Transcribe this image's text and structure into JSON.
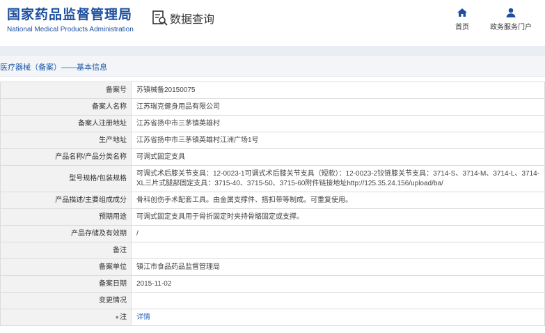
{
  "header": {
    "logo_cn": "国家药品监督管理局",
    "logo_en": "National Medical Products Administration",
    "query_label": "数据查询",
    "nav": [
      {
        "label": "首页",
        "icon": "home-icon"
      },
      {
        "label": "政务服务门户",
        "icon": "user-icon"
      }
    ]
  },
  "breadcrumb": "医疗器械（备案）——基本信息",
  "rows": [
    {
      "label": "备案号",
      "value": "苏镇械备20150075"
    },
    {
      "label": "备案人名称",
      "value": "江苏瑞克健身用品有限公司"
    },
    {
      "label": "备案人注册地址",
      "value": "江苏省扬中市三茅镇英雄村"
    },
    {
      "label": "生产地址",
      "value": "江苏省扬中市三茅镇英雄村江洲广场1号"
    },
    {
      "label": "产品名称/产品分类名称",
      "value": "可调式固定支具"
    },
    {
      "label": "型号规格/包装规格",
      "value": "可调式术后膝关节支具：12-0023-1可调式术后膝关节支具（短款）：12-0023-2铰链膝关节支具：3714-S、3714-M、3714-L、3714-XL三片式腿部固定支具：3715-40、3715-50、3715-60附件链接地址http://125.35.24.156/upload/ba/"
    },
    {
      "label": "产品描述/主要组成成分",
      "value": "骨科创伤手术配套工具。由金属支撑件、搭扣带等制成。可重复使用。"
    },
    {
      "label": "预期用途",
      "value": "可调式固定支具用于骨折固定时夹持骨骼固定或支撑。"
    },
    {
      "label": "产品存储及有效期",
      "value": "/"
    },
    {
      "label": "备注",
      "value": ""
    },
    {
      "label": "备案单位",
      "value": "镇江市食品药品监督管理局"
    },
    {
      "label": "备案日期",
      "value": "2015-11-02"
    },
    {
      "label": "变更情况",
      "value": ""
    },
    {
      "label": "注",
      "value": "详情",
      "bulb": "●"
    }
  ],
  "colors": {
    "brand": "#1d4f9e",
    "link": "#1d5aa8"
  }
}
